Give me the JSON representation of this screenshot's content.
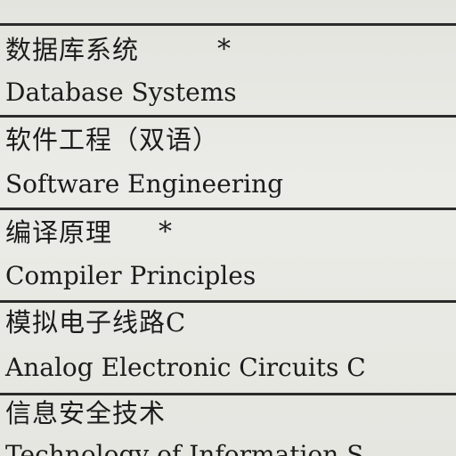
{
  "courses": [
    {
      "cn": "数据库系统",
      "mark": "*",
      "en": "Database Systems"
    },
    {
      "cn": "软件工程（双语）",
      "mark": "",
      "en": "Software  Engineering"
    },
    {
      "cn": "编译原理",
      "mark": "*",
      "en": "Compiler Principles"
    },
    {
      "cn": "模拟电子线路C",
      "mark": "",
      "en": "Analog Electronic Circuits C"
    },
    {
      "cn": "信息安全技术",
      "mark": "",
      "en": "Technology of Information S"
    }
  ]
}
